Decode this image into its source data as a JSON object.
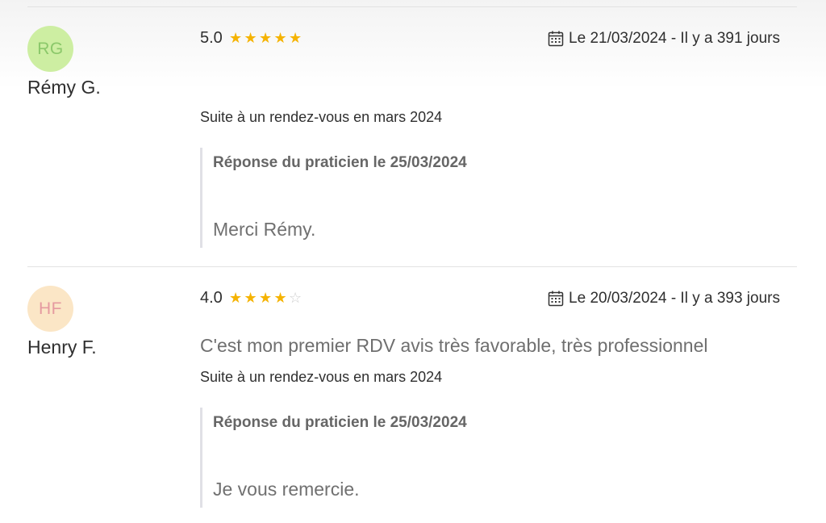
{
  "reviews": [
    {
      "initials": "RG",
      "avatar_bg": "#cdeea2",
      "avatar_fg": "#8bc86a",
      "author": "Rémy G.",
      "rating": "5.0",
      "stars_filled": 5,
      "stars_total": 5,
      "date": "Le 21/03/2024 - Il y a 391 jours",
      "comment": "",
      "context": "Suite à un rendez-vous en mars 2024",
      "reply_title": "Réponse du praticien le 25/03/2024",
      "reply_text": "Merci Rémy."
    },
    {
      "initials": "HF",
      "avatar_bg": "#fbe6c6",
      "avatar_fg": "#e59aa0",
      "author": "Henry F.",
      "rating": "4.0",
      "stars_filled": 4,
      "stars_total": 5,
      "date": "Le 20/03/2024 - Il y a 393 jours",
      "comment": "C'est mon premier RDV avis très favorable, très professionnel",
      "context": "Suite à un rendez-vous en mars 2024",
      "reply_title": "Réponse du praticien le 25/03/2024",
      "reply_text": "Je vous remercie."
    }
  ],
  "icons": {
    "calendar": "calendar-icon",
    "star": "star-icon"
  },
  "colors": {
    "star_filled": "#f5b301",
    "star_empty": "#cfcfcf"
  }
}
